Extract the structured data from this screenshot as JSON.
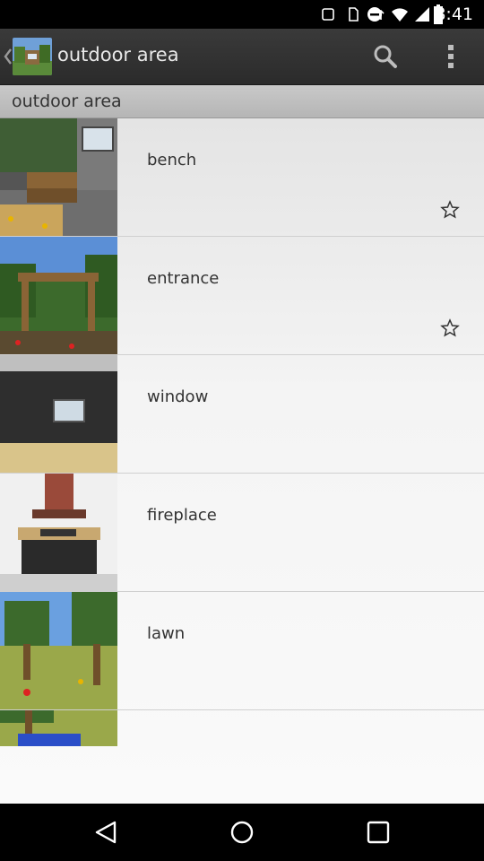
{
  "status_bar": {
    "time": "8:41"
  },
  "action_bar": {
    "title": "outdoor area"
  },
  "section": {
    "title": "outdoor area"
  },
  "items": [
    {
      "label": "bench",
      "starred": true
    },
    {
      "label": "entrance",
      "starred": true
    },
    {
      "label": "window",
      "starred": false
    },
    {
      "label": "fireplace",
      "starred": false
    },
    {
      "label": "lawn",
      "starred": false
    },
    {
      "label": "",
      "starred": false
    }
  ],
  "colors": {
    "action_bar": "#333333",
    "section_header": "#bfbfbf",
    "list_bg": "#f2f2f2",
    "status_bar": "#000000"
  }
}
